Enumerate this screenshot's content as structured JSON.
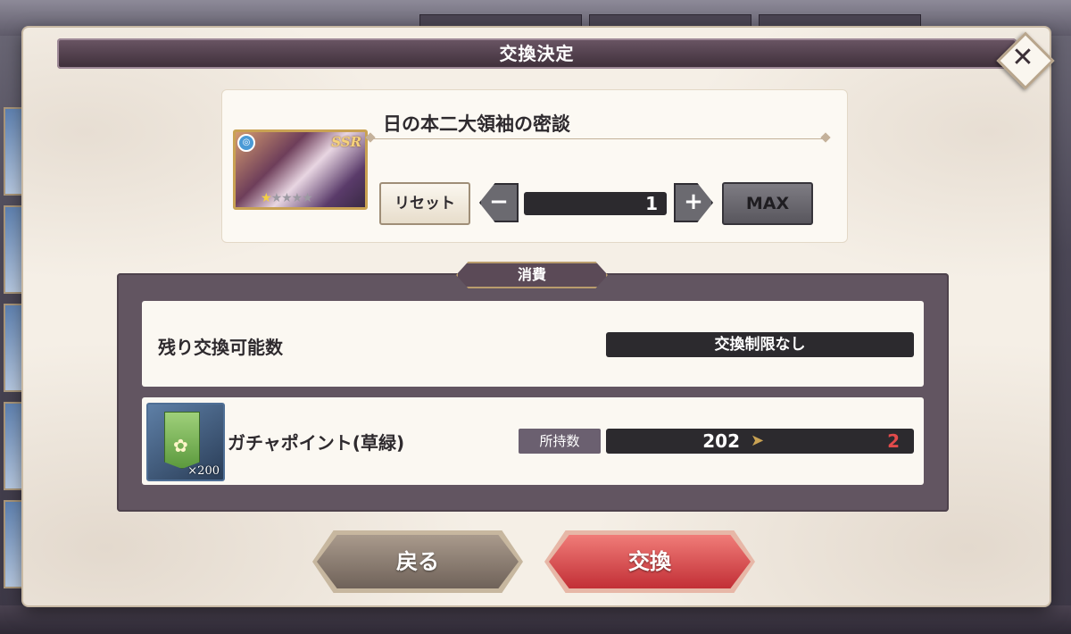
{
  "dialog": {
    "title": "交換決定",
    "close_glyph": "✕"
  },
  "item": {
    "name": "日の本二大領袖の密談",
    "rarity": "SSR",
    "stars": {
      "lit": "★",
      "unlit": "★★★★",
      "rating": 1,
      "max": 5
    },
    "reset_label": "リセット",
    "minus_glyph": "−",
    "plus_glyph": "+",
    "quantity": "1",
    "max_label": "MAX"
  },
  "consume": {
    "tag_label": "消費",
    "remaining_label": "残り交換可能数",
    "remaining_value": "交換制限なし",
    "point": {
      "name": "ガチャポイント(草緑)",
      "icon_count": "×200",
      "owned_label": "所持数",
      "owned_current": "202",
      "owned_after": "2"
    }
  },
  "buttons": {
    "back": "戻る",
    "exchange": "交換"
  },
  "colors": {
    "title_bar": "#4e3b48",
    "panel": "#625561",
    "exchange_button": "#d9434a",
    "back_button": "#8b7d72",
    "owned_after": "#e24b4b"
  },
  "icons": [
    "close-icon",
    "element-icon",
    "minus-icon",
    "plus-icon",
    "arrow-right-icon",
    "gacha-point-icon"
  ]
}
